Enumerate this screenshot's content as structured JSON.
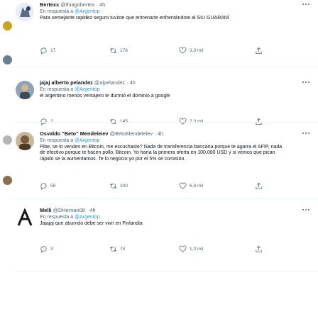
{
  "tweets": [
    {
      "name": "Bertexx",
      "handle": "@thiagobertex",
      "time": "4h",
      "reply_prefix": "En respuesta a",
      "reply_to": "@Argentop",
      "text": "Para semejante rapidez seguro tuviste que entrenarte enfrentándote al SIU GUARANÍ",
      "replies": "17",
      "retweets": "176",
      "likes": "3,3 mil"
    },
    {
      "name": "jajaj alberto pelandez",
      "handle": "@alpelandez",
      "time": "4h",
      "reply_prefix": "En respuesta a",
      "reply_to": "@Argentop",
      "text": "el argentino menos ventajero le durmió el dominio a google",
      "replies": "2",
      "retweets": "145",
      "likes": "2,3 mil"
    },
    {
      "name": "Osvaldo \"Beto\" Mendeleiev",
      "handle": "@BetoMendeleiev",
      "time": "4h",
      "reply_prefix": "En respuesta a",
      "reply_to": "@Argentop",
      "text": "Pibe, se lo vendes en Bitcoin, me escuchaste? Nada de transferencia bancaria porque te agarra el AFIP, nada de efectivo porque te hacen pollo, Bitcoin. Yo haría la primera oferta en 100.000 USD y si vemos que pican rápido se la aumentamos. Te lo negocio yo por el 5% se comisión.",
      "replies": "58",
      "retweets": "240",
      "likes": "6,6 mil"
    },
    {
      "name": "Melli",
      "handle": "@DHernan08",
      "time": "4h",
      "reply_prefix": "En respuesta a",
      "reply_to": "@Argentop",
      "text": "Jajajaj que aburrido debe ser vivir en Finlandia",
      "replies": "3",
      "retweets": "74",
      "likes": "1,3 mil"
    }
  ],
  "icons": {
    "reply": "reply-icon",
    "retweet": "retweet-icon",
    "like": "heart-icon",
    "share": "share-icon",
    "more": "more-options-icon"
  },
  "colors": {
    "text": "#0f1419",
    "secondary": "#536471",
    "link": "#1d9bf0"
  }
}
